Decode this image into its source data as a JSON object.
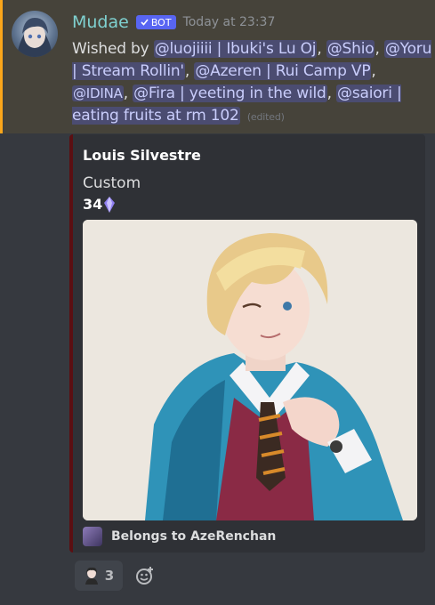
{
  "message": {
    "username": "Mudae",
    "bot_label": "BOT",
    "timestamp": "Today at 23:37",
    "wished_by": "Wished by",
    "mentions": [
      "@luojiiii | Ibuki's Lu Oj",
      "@Shio",
      "@Yoru | Stream Rollin'",
      "@Azeren | Rui Camp VP",
      "@IDINA",
      "@Fira | yeeting in the wild",
      "@saiori | eating fruits at rm 102"
    ],
    "edited": "(edited)"
  },
  "embed": {
    "title": "Louis Silvestre",
    "description": "Custom",
    "value": "34",
    "value_icon": "kakera-crystal-icon",
    "footer": "Belongs to AzeRenchan",
    "accent_color": "#5b0f12"
  },
  "reactions": {
    "count": "3",
    "add_icon": "add-reaction-icon"
  },
  "colors": {
    "highlight_bg": "#46433a",
    "highlight_border": "#faa61a",
    "username": "#7fd1d0",
    "mention_text": "#c9cdfb"
  }
}
